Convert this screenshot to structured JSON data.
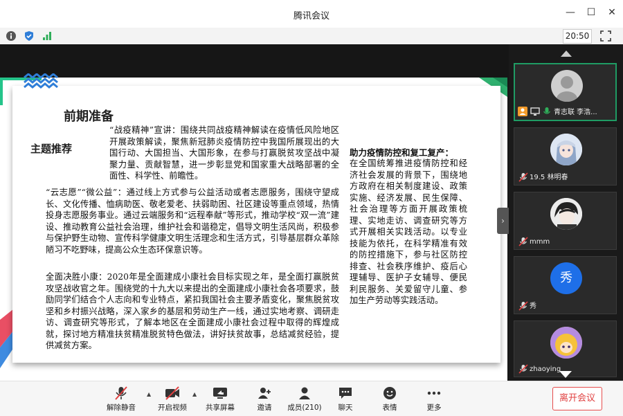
{
  "window": {
    "title": "腾讯会议",
    "clock": "20:50"
  },
  "slide": {
    "heading": "前期准备",
    "subhead": "主题推荐",
    "p1": "“战疫精神”宣讲：围绕共同战疫精神解读在疫情低风险地区开展政策解读，聚焦新冠肺炎疫情防控中我国所展现出的大国行动、大国担当、大国形象，在参与打赢脱贫攻坚战中凝聚力量、贡献智慧，进一步彰显党和国家重大战略部署的全面性、科学性、前瞻性。",
    "p2": "“云志愿”“微公益”：通过线上方式参与公益活动或者志愿服务，围绕守望成长、文化传播、恤病助医、敬老爱老、扶弱助困、社区建设等重点领域，热情投身志愿服务事业。通过云端服务和“远程奉献”等形式，推动学校“双一流”建设、推动教育公益社会治理，维护社会和谐稳定，倡导文明生活风尚，积极参与保护野生动物、宣传科学健康文明生活理念和生活方式，引导基层群众革除陋习不吃野味，提高公众生态环保意识等。",
    "p3": "全面决胜小康：2020年是全面建成小康社会目标实现之年，是全面打赢脱贫攻坚战收官之年。围绕党的十九大以来提出的全面建成小康社会各项要求，鼓励同学们结合个人志向和专业特点，紧扣我国社会主要矛盾变化，聚焦脱贫攻坚和乡村振兴战略，深入家乡的基层和劳动生产一线，通过实地考察、调研走访、调查研究等形式，了解本地区在全面建成小康社会过程中取得的辉煌成就，探讨地方精准扶贫精准脱贫特色做法，讲好扶贫故事，总结减贫经验，提供减贫方案。",
    "right_title": "助力疫情防控和复工复产：",
    "right_body": "在全国统筹推进疫情防控和经济社会发展的背景下，围绕地方政府在相关制度建设、政策实施、经济发展、民生保障、社会治理等方面开展政策梳理、实地走访、调查研究等方式开展相关实践活动。以专业技能为依托，在科学精准有效的防控措施下，参与社区防控排查、社会秩序维护、疫后心理辅导、医护子女辅导、便民利民服务、关爱留守儿童、参加生产劳动等实践活动。"
  },
  "participants": [
    {
      "name": "青志联 李浩...",
      "avatar": "gray"
    },
    {
      "name": "19.5 林明春",
      "avatar": "anime-girl"
    },
    {
      "name": "mmm",
      "avatar": "anime-boy"
    },
    {
      "name": "秀",
      "avatar": "text",
      "avatar_text": "秀",
      "avatar_color": "#1e6fe8"
    },
    {
      "name": "zhaoying",
      "avatar": "anime-yellow"
    }
  ],
  "toolbar": {
    "unmute": "解除静音",
    "video": "开启视频",
    "share": "共享屏幕",
    "invite": "邀请",
    "members": "成员(210)",
    "chat": "聊天",
    "emoji": "表情",
    "more": "更多",
    "leave": "离开会议"
  },
  "colors": {
    "accent_green": "#1f9c64",
    "leave_red": "#e04040",
    "wave_blue": "#2f7ed8"
  }
}
